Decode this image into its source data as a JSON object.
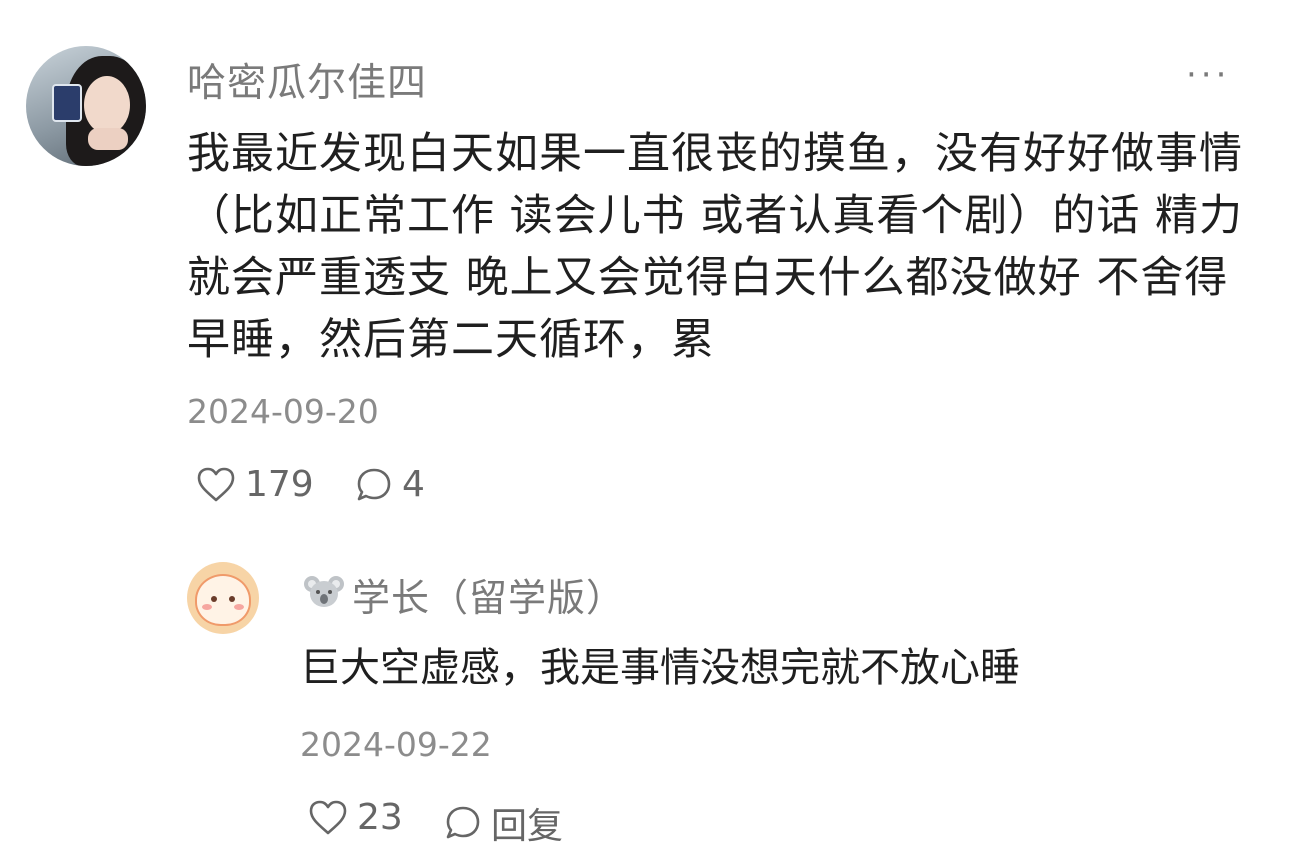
{
  "comment": {
    "author": "哈密瓜尔佳四",
    "text": "我最近发现白天如果一直很丧的摸鱼，没有好好做事情（比如正常工作 读会儿书 或者认真看个剧）的话 精力就会严重透支 晚上又会觉得白天什么都没做好 不舍得早睡，然后第二天循环，累",
    "date": "2024-09-20",
    "like_count": "179",
    "reply_count": "4",
    "more_icon": "ellipsis-icon",
    "like_icon": "heart-outline-icon",
    "reply_icon": "chat-bubble-icon"
  },
  "reply": {
    "author": "学长（留学版）",
    "author_badge_icon": "koala-icon",
    "text": "巨大空虚感，我是事情没想完就不放心睡",
    "date": "2024-09-22",
    "like_count": "23",
    "reply_label": "回复",
    "like_icon": "heart-outline-icon",
    "reply_icon": "chat-bubble-icon"
  },
  "colors": {
    "username": "#7a7a7a",
    "text": "#1f1f1f",
    "meta": "#8c8c8c",
    "icon": "#666666"
  }
}
